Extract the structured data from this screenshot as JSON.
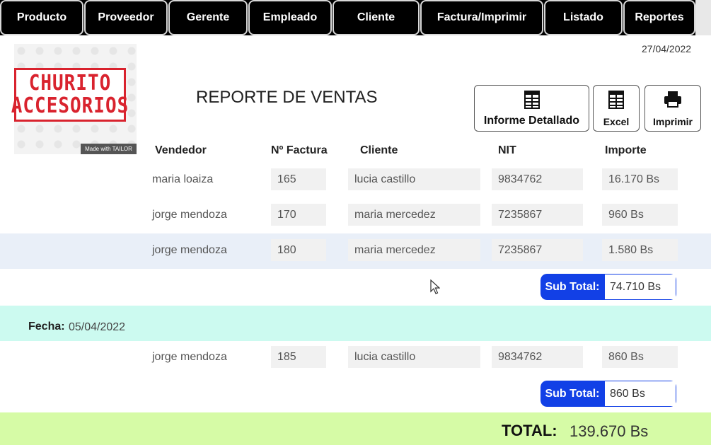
{
  "nav": {
    "items": [
      {
        "label": "Producto"
      },
      {
        "label": "Proveedor"
      },
      {
        "label": "Gerente"
      },
      {
        "label": "Empleado"
      },
      {
        "label": "Cliente"
      },
      {
        "label": "Factura/Imprimir"
      },
      {
        "label": "Listado"
      },
      {
        "label": "Reportes"
      }
    ]
  },
  "logo": {
    "line1": "CHURITO",
    "line2": "ACCESORIOS",
    "made_with": "Made with TAILOR"
  },
  "report": {
    "title": "REPORTE DE VENTAS",
    "date": "27/04/2022"
  },
  "actions": {
    "detailed": "Informe Detallado",
    "excel": "Excel",
    "print": "Imprimir"
  },
  "table": {
    "headers": {
      "vendor": "Vendedor",
      "invoice": "Nº Factura",
      "client": "Cliente",
      "nit": "NIT",
      "amount": "Importe"
    }
  },
  "groups": [
    {
      "rows": [
        {
          "vendor": "maria loaiza",
          "invoice": "165",
          "client": "lucia castillo",
          "nit": "9834762",
          "amount": "16.170 Bs"
        },
        {
          "vendor": "jorge mendoza",
          "invoice": "170",
          "client": "maria mercedez",
          "nit": "7235867",
          "amount": "960 Bs"
        },
        {
          "vendor": "jorge mendoza",
          "invoice": "180",
          "client": "maria mercedez",
          "nit": "7235867",
          "amount": "1.580 Bs"
        }
      ],
      "subtotal_label": "Sub Total:",
      "subtotal": "74.710 Bs"
    },
    {
      "date_label": "Fecha:",
      "date": "05/04/2022",
      "rows": [
        {
          "vendor": "jorge mendoza",
          "invoice": "185",
          "client": "lucia castillo",
          "nit": "9834762",
          "amount": "860 Bs"
        }
      ],
      "subtotal_label": "Sub Total:",
      "subtotal": "860 Bs"
    }
  ],
  "total": {
    "label": "TOTAL:",
    "value": "139.670 Bs"
  },
  "colors": {
    "nav_bg": "#000000",
    "subtotal_accent": "#1240e6",
    "date_band": "#ccfaf0",
    "highlight_row": "#e9eff8",
    "total_band": "#d6fba6",
    "logo_red": "#d9232e"
  }
}
